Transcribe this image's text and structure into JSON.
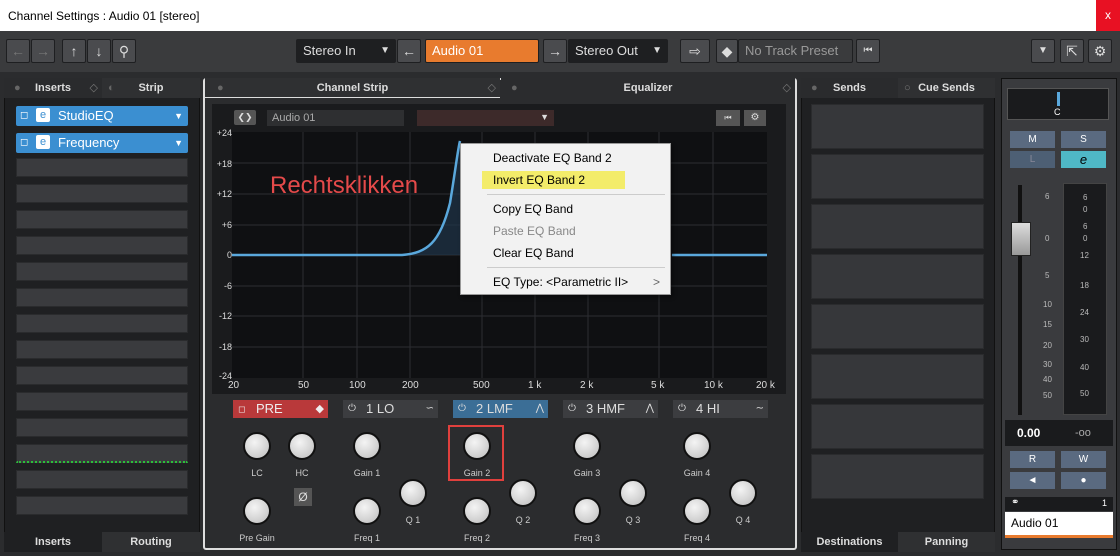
{
  "window": {
    "title": "Channel Settings : Audio 01 [stereo]",
    "close": "x"
  },
  "toolbar": {
    "input": "Stereo In",
    "channel": "Audio 01",
    "output": "Stereo Out",
    "preset": "No Track Preset"
  },
  "left_tabs": {
    "inserts": "Inserts",
    "strip": "Strip"
  },
  "inserts": [
    {
      "name": "StudioEQ"
    },
    {
      "name": "Frequency"
    }
  ],
  "left_bottom_tabs": {
    "inserts": "Inserts",
    "routing": "Routing"
  },
  "center_tabs": {
    "channel_strip": "Channel Strip",
    "equalizer": "Equalizer"
  },
  "eq": {
    "channel": "Audio 01",
    "annotation": "Rechtsklikken",
    "y_labels": [
      "+24",
      "+18",
      "+12",
      "+6",
      "0",
      "-6",
      "-12",
      "-18",
      "-24"
    ],
    "x_labels": [
      "20",
      "50",
      "100",
      "200",
      "500",
      "1 k",
      "2 k",
      "5 k",
      "10 k",
      "20 k"
    ],
    "bands": [
      {
        "name": "PRE"
      },
      {
        "name": "1 LO"
      },
      {
        "name": "2 LMF"
      },
      {
        "name": "3 HMF"
      },
      {
        "name": "4 HI"
      }
    ],
    "knobs": {
      "lc": "LC",
      "hc": "HC",
      "pre_gain": "Pre Gain",
      "gain1": "Gain 1",
      "freq1": "Freq 1",
      "q1": "Q 1",
      "gain2": "Gain 2",
      "freq2": "Freq 2",
      "q2": "Q 2",
      "gain3": "Gain 3",
      "freq3": "Freq 3",
      "q3": "Q 3",
      "gain4": "Gain 4",
      "freq4": "Freq 4",
      "q4": "Q 4"
    },
    "phase": "Ø"
  },
  "context_menu": {
    "items": [
      "Deactivate EQ Band 2",
      "Invert EQ Band 2",
      "Copy EQ Band",
      "Paste EQ Band",
      "Clear EQ Band",
      "EQ Type: <Parametric II>"
    ],
    "submenu_arrow": ">"
  },
  "right_tabs": {
    "sends": "Sends",
    "cue_sends": "Cue Sends"
  },
  "right_bottom_tabs": {
    "destinations": "Destinations",
    "panning": "Panning"
  },
  "fader": {
    "pan": "C",
    "m": "M",
    "s": "S",
    "l": "L",
    "e": "e",
    "volume": "0.00",
    "peak": "-oo",
    "r": "R",
    "w": "W",
    "channel_number": "1",
    "channel_name": "Audio 01",
    "scale_left": [
      "6",
      "0",
      "5",
      "10",
      "15",
      "20",
      "30",
      "40",
      "50"
    ],
    "scale_right": [
      "6",
      "0",
      "12",
      "18",
      "24",
      "30",
      "40",
      "50"
    ],
    "scale_right_extra": [
      "6",
      "0"
    ]
  }
}
